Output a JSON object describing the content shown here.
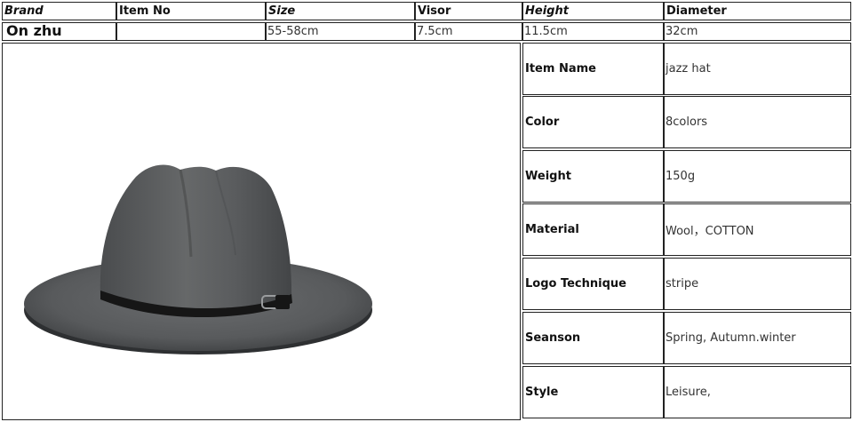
{
  "header": {
    "brand": "Brand",
    "item_no": "Item No",
    "size": "Size",
    "visor": "Visor",
    "height": "Height",
    "diameter": "Diameter"
  },
  "row": {
    "brand": "On zhu",
    "item_no": "",
    "size": "55-58cm",
    "visor": "7.5cm",
    "height": "11.5cm",
    "diameter": "32cm"
  },
  "image": {
    "icon": "fedora-hat-icon",
    "hat_color": "#5a5c5e",
    "band_color": "#161616"
  },
  "properties": [
    {
      "label": "Item Name",
      "value": "jazz hat"
    },
    {
      "label": "Color",
      "value": "8colors"
    },
    {
      "label": "Weight",
      "value": "150g"
    },
    {
      "label": "Material",
      "value": "Wool，COTTON"
    },
    {
      "label": "Logo Technique",
      "value": "stripe"
    },
    {
      "label": "Seanson",
      "value": "Spring, Autumn.winter"
    },
    {
      "label": "Style",
      "value": "Leisure,"
    }
  ]
}
